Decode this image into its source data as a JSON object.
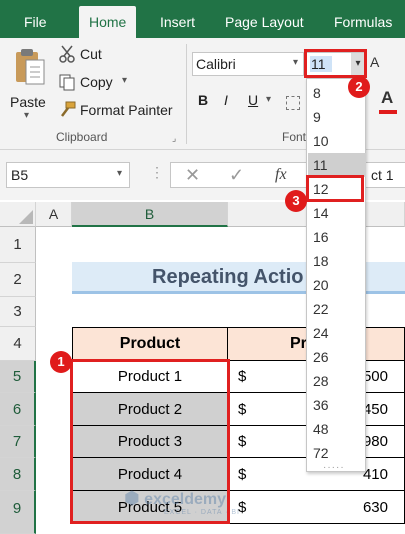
{
  "tabs": [
    {
      "label": "File",
      "active": false
    },
    {
      "label": "Home",
      "active": true
    },
    {
      "label": "Insert",
      "active": false
    },
    {
      "label": "Page Layout",
      "active": false
    },
    {
      "label": "Formulas",
      "active": false
    }
  ],
  "clipboard": {
    "paste_label": "Paste",
    "cut_label": "Cut",
    "copy_label": "Copy",
    "format_painter_label": "Format Painter",
    "group_label": "Clipboard"
  },
  "font": {
    "font_name": "Calibri",
    "font_size": "11",
    "group_label_partial": "Font",
    "bold": "B",
    "italic": "I",
    "underline": "U",
    "font_color": "A"
  },
  "formula_bar": {
    "name_box": "B5",
    "fx": "fx",
    "content_partial": "ct 1"
  },
  "columns": [
    "A",
    "B"
  ],
  "rows": [
    "1",
    "2",
    "3",
    "4",
    "5",
    "6",
    "7",
    "8",
    "9"
  ],
  "sheet": {
    "title": "Repeating Actio",
    "header_product": "Product",
    "header_price_partial": "Pr",
    "products": [
      "Product 1",
      "Product 2",
      "Product 3",
      "Product 4",
      "Product 5"
    ],
    "currency": [
      "$",
      "$",
      "$",
      "$",
      "$"
    ],
    "prices_partial": [
      "500",
      "450",
      "980",
      "410",
      "630"
    ]
  },
  "font_size_options": [
    "8",
    "9",
    "10",
    "11",
    "12",
    "14",
    "16",
    "18",
    "20",
    "22",
    "24",
    "26",
    "28",
    "36",
    "48",
    "72"
  ],
  "callouts": [
    "1",
    "2",
    "3"
  ],
  "watermark": {
    "brand": "exceldemy",
    "tagline": "EXCEL · DATA · BI"
  },
  "colors": {
    "excel_green": "#217346",
    "header_fill": "#fce4d6",
    "title_fill": "#ddebf7",
    "selected_fill": "#d0d0d0",
    "callout_red": "#e01b1b"
  }
}
